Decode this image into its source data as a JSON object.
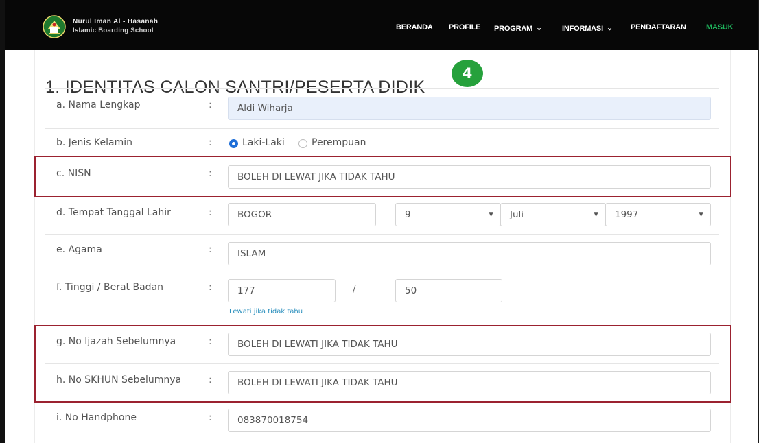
{
  "brand": {
    "line1": "Nurul Iman Al - Hasanah",
    "line2": "Islamic Boarding School",
    "logo_icon": "school-crest-icon"
  },
  "nav": {
    "items": [
      {
        "label": "BERANDA",
        "dropdown": false
      },
      {
        "label": "PROFILE",
        "dropdown": false
      },
      {
        "label": "PROGRAM",
        "dropdown": true
      },
      {
        "label": "INFORMASI",
        "dropdown": true
      },
      {
        "label": "PENDAFTARAN",
        "dropdown": false
      },
      {
        "label": "MASUK",
        "dropdown": false
      }
    ],
    "chevron": "⌄",
    "active_color": "#1fb35c"
  },
  "section": {
    "title": "1. IDENTITAS CALON SANTRI/PESERTA DIDIK",
    "step": "4"
  },
  "separator": ":",
  "form": {
    "nama": {
      "label": "a. Nama Lengkap",
      "value": "Aldi Wiharja"
    },
    "jenis_kelamin": {
      "label": "b. Jenis Kelamin",
      "options": [
        "Laki-Laki",
        "Perempuan"
      ],
      "selected": "Laki-Laki"
    },
    "nisn": {
      "label": "c. NISN",
      "value": "BOLEH DI LEWAT JIKA TIDAK TAHU"
    },
    "ttl": {
      "label": "d. Tempat Tanggal Lahir",
      "tempat": "BOGOR",
      "tanggal": "9",
      "bulan": "Juli",
      "tahun": "1997",
      "caret": "▼"
    },
    "agama": {
      "label": "e. Agama",
      "value": "ISLAM"
    },
    "tinggi_berat": {
      "label": "f. Tinggi / Berat Badan",
      "tinggi": "177",
      "berat": "50",
      "slash": "/",
      "hint": "Lewati jika tidak tahu"
    },
    "ijazah": {
      "label": "g. No Ijazah Sebelumnya",
      "value": "BOLEH DI LEWATI JIKA TIDAK TAHU"
    },
    "skhun": {
      "label": "h. No SKHUN Sebelumnya",
      "value": "BOLEH DI LEWATI JIKA TIDAK TAHU"
    },
    "handphone": {
      "label": "i. No Handphone",
      "value": "083870018754"
    }
  },
  "colors": {
    "highlight": "#9b2230",
    "badge": "#26a13c",
    "radio_selected": "#1f6fd8",
    "filled_field": "#e9f0fb"
  }
}
